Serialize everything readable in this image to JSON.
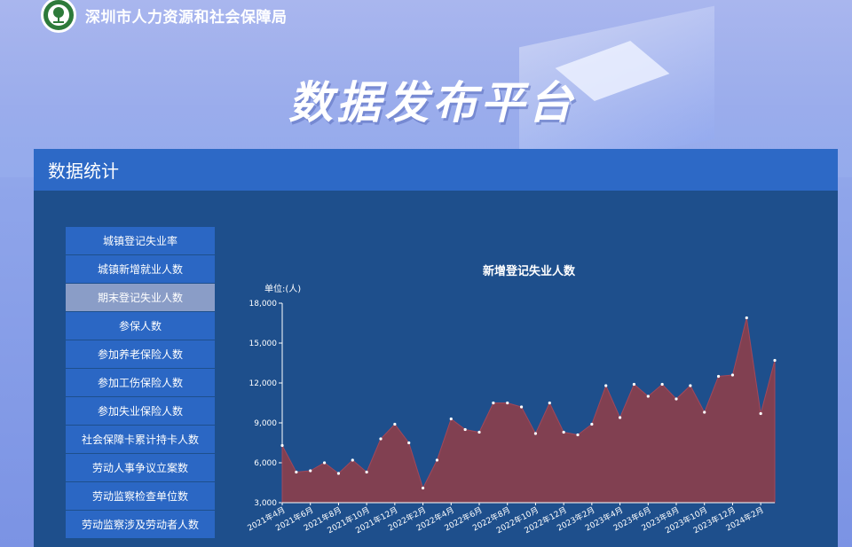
{
  "header": {
    "org_name": "深圳市人力资源和社会保障局",
    "platform_title": "数据发布平台"
  },
  "panel": {
    "title": "数据统计"
  },
  "menu": {
    "items": [
      {
        "label": "城镇登记失业率"
      },
      {
        "label": "城镇新增就业人数"
      },
      {
        "label": "期末登记失业人数",
        "active": true
      },
      {
        "label": "参保人数"
      },
      {
        "label": "参加养老保险人数"
      },
      {
        "label": "参加工伤保险人数"
      },
      {
        "label": "参加失业保险人数"
      },
      {
        "label": "社会保障卡累计持卡人数"
      },
      {
        "label": "劳动人事争议立案数"
      },
      {
        "label": "劳动监察检查单位数"
      },
      {
        "label": "劳动监察涉及劳动者人数"
      }
    ]
  },
  "chart_data": {
    "type": "area",
    "title": "新增登记失业人数",
    "unit_label": "单位:(人)",
    "ylim": [
      3000,
      18000
    ],
    "yticks": [
      "3,000",
      "6,000",
      "9,000",
      "12,000",
      "15,000",
      "18,000"
    ],
    "xtick_labels": [
      "2021年4月",
      "2021年6月",
      "2021年8月",
      "2021年10月",
      "2021年12月",
      "2022年2月",
      "2022年4月",
      "2022年6月",
      "2022年8月",
      "2022年10月",
      "2022年12月",
      "2023年2月",
      "2023年4月",
      "2023年6月",
      "2023年8月",
      "2023年10月",
      "2023年12月",
      "2024年2月"
    ],
    "series": [
      {
        "values": [
          7300,
          5300,
          5400,
          6000,
          5200,
          6200,
          5300,
          7800,
          8900,
          7500,
          4100,
          6200,
          9300,
          8500,
          8300,
          10500,
          10500,
          10200,
          8200,
          10500,
          8300,
          8100,
          8900,
          11800,
          9400,
          11900,
          11000,
          11900,
          10800,
          11800,
          9800,
          12500,
          12600,
          16900,
          9700,
          13700
        ]
      }
    ],
    "colors": {
      "fill": "#8a3f4c",
      "line": "#a3485a",
      "point": "#ffffff",
      "axis": "#ffffff"
    }
  }
}
